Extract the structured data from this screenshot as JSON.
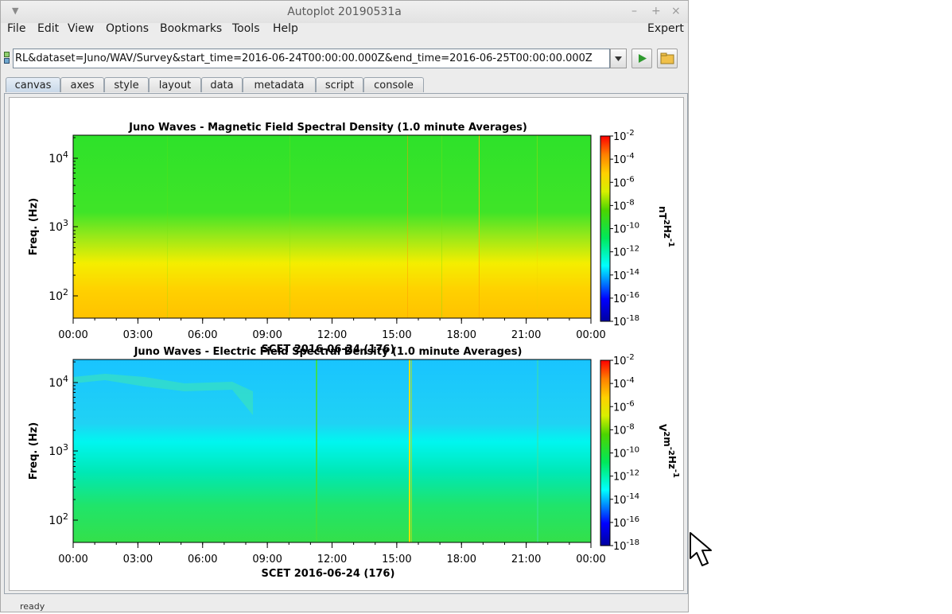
{
  "window": {
    "title": "Autoplot 20190531a"
  },
  "menu": [
    "File",
    "Edit",
    "View",
    "Options",
    "Bookmarks",
    "Tools",
    "Help"
  ],
  "menu_right": "Expert",
  "url": "RL&dataset=Juno/WAV/Survey&start_time=2016-06-24T00:00:00.000Z&end_time=2016-06-25T00:00:00.000Z",
  "tabs": [
    "canvas",
    "axes",
    "style",
    "layout",
    "data",
    "metadata",
    "script",
    "console"
  ],
  "active_tab": "canvas",
  "status": "ready",
  "chart_data": [
    {
      "type": "heatmap",
      "title": "Juno Waves - Magnetic Field Spectral Density (1.0 minute Averages)",
      "ylabel": "Freq. (Hz)",
      "xlabel": "SCET 2016-06-24 (176)",
      "x_ticks": [
        "00:00",
        "03:00",
        "06:00",
        "09:00",
        "12:00",
        "15:00",
        "18:00",
        "21:00",
        "00:00"
      ],
      "y_ticks": [
        "10^4",
        "10^3",
        "10^2"
      ],
      "yscale": "log",
      "colorbar_ticks": [
        "10^-2",
        "10^-4",
        "10^-6",
        "10^-8",
        "10^-10",
        "10^-12",
        "10^-14",
        "10^-16",
        "10^-18"
      ],
      "colorbar_label": "nT^2 Hz^-1",
      "colorscale": "log"
    },
    {
      "type": "heatmap",
      "title": "Juno Waves - Electric Field Spectral Density (1.0 minute Averages)",
      "ylabel": "Freq. (Hz)",
      "xlabel": "SCET 2016-06-24 (176)",
      "x_ticks": [
        "00:00",
        "03:00",
        "06:00",
        "09:00",
        "12:00",
        "15:00",
        "18:00",
        "21:00",
        "00:00"
      ],
      "y_ticks": [
        "10^4",
        "10^3",
        "10^2"
      ],
      "yscale": "log",
      "colorbar_ticks": [
        "10^-2",
        "10^-4",
        "10^-6",
        "10^-8",
        "10^-10",
        "10^-12",
        "10^-14",
        "10^-16",
        "10^-18"
      ],
      "colorbar_label": "V^2 m^-2 Hz^-1",
      "colorscale": "log"
    }
  ]
}
